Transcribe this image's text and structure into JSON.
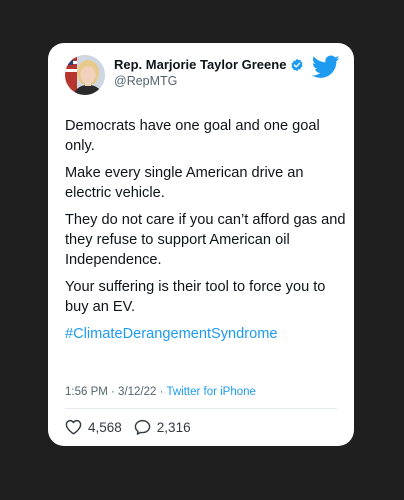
{
  "tweet": {
    "author": {
      "name": "Rep. Marjorie Taylor Greene",
      "handle": "@RepMTG"
    },
    "paragraphs": [
      "Democrats have one goal and one goal only.",
      "Make every single American drive an electric vehicle.",
      "They do not care if you can’t afford gas and they refuse to support American oil Independence.",
      "Your suffering is their tool to force you to buy an EV."
    ],
    "hashtag": "#ClimateDerangementSyndrome",
    "timestamp": "1:56 PM · 3/12/22 · ",
    "source": "Twitter for iPhone",
    "likes": "4,568",
    "replies": "2,316"
  },
  "icons": {
    "avatar": "profile-photo",
    "verified": "verified-badge-icon",
    "logo": "twitter-bird-icon",
    "like": "heart-icon",
    "reply": "reply-bubble-icon"
  },
  "colors": {
    "background": "#1f1f1f",
    "card": "#ffffff",
    "text": "#0f1419",
    "muted": "#536471",
    "twitter_blue": "#1d9bf0"
  }
}
